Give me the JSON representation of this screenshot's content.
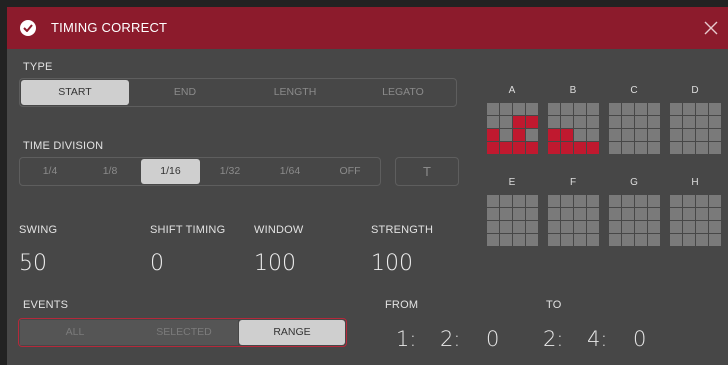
{
  "title": "TIMING CORRECT",
  "type": {
    "label": "TYPE",
    "options": [
      "START",
      "END",
      "LENGTH",
      "LEGATO"
    ],
    "selected": "START"
  },
  "time_division": {
    "label": "TIME DIVISION",
    "options": [
      "1/4",
      "1/8",
      "1/16",
      "1/32",
      "1/64",
      "OFF"
    ],
    "selected": "1/16",
    "t_button": "T"
  },
  "params": {
    "swing_label": "SWING",
    "swing_value": "50",
    "shift_label": "SHIFT TIMING",
    "shift_value": "0",
    "window_label": "WINDOW",
    "window_value": "100",
    "strength_label": "STRENGTH",
    "strength_value": "100"
  },
  "events": {
    "label": "EVENTS",
    "options": [
      "ALL",
      "SELECTED",
      "RANGE"
    ],
    "selected": "RANGE"
  },
  "range": {
    "from_label": "FROM",
    "from_bar": "1:",
    "from_beat": "2:",
    "from_tick": "0",
    "to_label": "TO",
    "to_bar": "2:",
    "to_beat": "4:",
    "to_tick": "0"
  },
  "pad_banks": {
    "labels": [
      "A",
      "B",
      "C",
      "D",
      "E",
      "F",
      "G",
      "H"
    ],
    "active_pads": {
      "A": [
        6,
        7,
        8,
        10,
        12,
        13,
        14,
        15
      ],
      "B": [
        8,
        9,
        12,
        13,
        14,
        15
      ]
    }
  },
  "colors": {
    "title_bar": "#8c1b2c",
    "accent_red": "#c0192f",
    "panel": "#474747",
    "selected_option": "#cfcfcf"
  },
  "icons": {
    "title": "check-circle-icon",
    "close": "close-icon"
  }
}
